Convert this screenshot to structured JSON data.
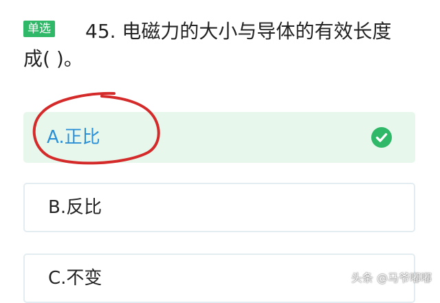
{
  "question": {
    "type_badge": "单选",
    "text_line1": "45. 电磁力的大小与导体的有效长度",
    "text_line2": "成(    )。"
  },
  "options": [
    {
      "label": "A.正比",
      "state": "correct"
    },
    {
      "label": "B.反比",
      "state": "default"
    },
    {
      "label": "C.不变",
      "state": "default"
    }
  ],
  "watermark": "头条 @马爷嘟嘟",
  "colors": {
    "badge_bg": "#2fb868",
    "correct_bg": "#e7f7ec",
    "correct_text": "#2b8fd6",
    "check_icon": "#2fb868",
    "annotation_circle": "#d42a2a"
  }
}
